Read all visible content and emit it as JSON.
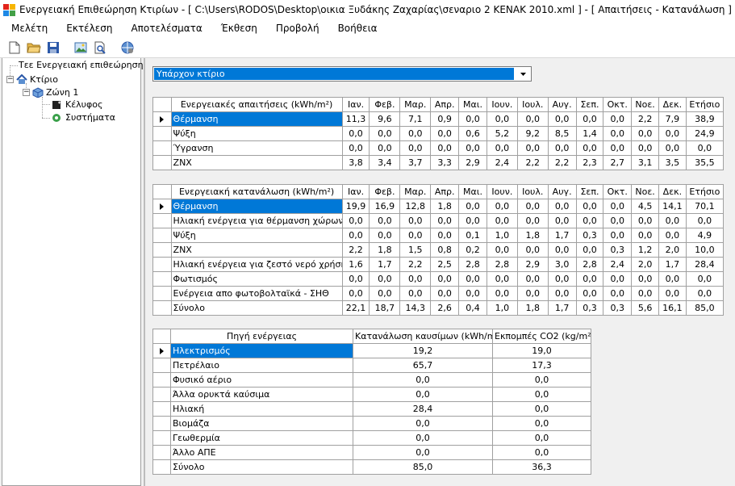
{
  "window": {
    "title": "Ενεργειακή Επιθεώρηση Κτιρίων - [ C:\\Users\\RODOS\\Desktop\\οικια Ξυδάκης Ζαχαρίας\\σεναριο 2 ΚΕΝΑΚ 2010.xml ] - [ Απαιτήσεις - Κατανάλωση ]"
  },
  "menu": [
    "Μελέτη",
    "Εκτέλεση",
    "Αποτελέσματα",
    "Έκθεση",
    "Προβολή",
    "Βοήθεια"
  ],
  "tree": {
    "root": "Τεε Ενεργειακή επιθεώρηση",
    "building": "Κτίριο",
    "zone": "Ζώνη 1",
    "shell": "Κέλυφος",
    "systems": "Συστήματα"
  },
  "combo": {
    "value": "Υπάρχον κτίριο"
  },
  "months": [
    "Ιαν.",
    "Φεβ.",
    "Μαρ.",
    "Απρ.",
    "Μαι.",
    "Ιουν.",
    "Ιουλ.",
    "Αυγ.",
    "Σεπ.",
    "Οκτ.",
    "Νοε.",
    "Δεκ.",
    "Ετήσιο"
  ],
  "demand": {
    "header": "Ενεργειακές απαιτήσεις (kWh/m²)",
    "rows": [
      {
        "label": "Θέρμανση",
        "values": [
          "11,3",
          "9,6",
          "7,1",
          "0,9",
          "0,0",
          "0,0",
          "0,0",
          "0,0",
          "0,0",
          "0,0",
          "2,2",
          "7,9",
          "38,9"
        ]
      },
      {
        "label": "Ψύξη",
        "values": [
          "0,0",
          "0,0",
          "0,0",
          "0,0",
          "0,6",
          "5,2",
          "9,2",
          "8,5",
          "1,4",
          "0,0",
          "0,0",
          "0,0",
          "24,9"
        ]
      },
      {
        "label": "Ύγρανση",
        "values": [
          "0,0",
          "0,0",
          "0,0",
          "0,0",
          "0,0",
          "0,0",
          "0,0",
          "0,0",
          "0,0",
          "0,0",
          "0,0",
          "0,0",
          "0,0"
        ]
      },
      {
        "label": "ZNX",
        "values": [
          "3,8",
          "3,4",
          "3,7",
          "3,3",
          "2,9",
          "2,4",
          "2,2",
          "2,2",
          "2,3",
          "2,7",
          "3,1",
          "3,5",
          "35,5"
        ]
      }
    ]
  },
  "consumption": {
    "header": "Ενεργειακή κατανάλωση (kWh/m²)",
    "rows": [
      {
        "label": "Θέρμανση",
        "values": [
          "19,9",
          "16,9",
          "12,8",
          "1,8",
          "0,0",
          "0,0",
          "0,0",
          "0,0",
          "0,0",
          "0,0",
          "4,5",
          "14,1",
          "70,1"
        ]
      },
      {
        "label": "Ηλιακή ενέργεια για θέρμανση χώρων",
        "values": [
          "0,0",
          "0,0",
          "0,0",
          "0,0",
          "0,0",
          "0,0",
          "0,0",
          "0,0",
          "0,0",
          "0,0",
          "0,0",
          "0,0",
          "0,0"
        ]
      },
      {
        "label": "Ψύξη",
        "values": [
          "0,0",
          "0,0",
          "0,0",
          "0,0",
          "0,1",
          "1,0",
          "1,8",
          "1,7",
          "0,3",
          "0,0",
          "0,0",
          "0,0",
          "4,9"
        ]
      },
      {
        "label": "ZNX",
        "values": [
          "2,2",
          "1,8",
          "1,5",
          "0,8",
          "0,2",
          "0,0",
          "0,0",
          "0,0",
          "0,0",
          "0,3",
          "1,2",
          "2,0",
          "10,0"
        ]
      },
      {
        "label": "Ηλιακή ενέργεια για ζεστό νερό χρήσης",
        "values": [
          "1,6",
          "1,7",
          "2,2",
          "2,5",
          "2,8",
          "2,8",
          "2,9",
          "3,0",
          "2,8",
          "2,4",
          "2,0",
          "1,7",
          "28,4"
        ]
      },
      {
        "label": "Φωτισμός",
        "values": [
          "0,0",
          "0,0",
          "0,0",
          "0,0",
          "0,0",
          "0,0",
          "0,0",
          "0,0",
          "0,0",
          "0,0",
          "0,0",
          "0,0",
          "0,0"
        ]
      },
      {
        "label": "Ενέργεια απο φωτοβολταϊκά - ΣΗΘ",
        "values": [
          "0,0",
          "0,0",
          "0,0",
          "0,0",
          "0,0",
          "0,0",
          "0,0",
          "0,0",
          "0,0",
          "0,0",
          "0,0",
          "0,0",
          "0,0"
        ]
      },
      {
        "label": "Σύνολο",
        "values": [
          "22,1",
          "18,7",
          "14,3",
          "2,6",
          "0,4",
          "1,0",
          "1,8",
          "1,7",
          "0,3",
          "0,3",
          "5,6",
          "16,1",
          "85,0"
        ]
      }
    ]
  },
  "sources": {
    "headers": [
      "Πηγή ενέργειας",
      "Κατανάλωση καυσίμων (kWh/m²)",
      "Εκπομπές CO2 (kg/m²)"
    ],
    "rows": [
      {
        "label": "Ηλεκτρισμός",
        "fuel": "19,2",
        "co2": "19,0"
      },
      {
        "label": "Πετρέλαιο",
        "fuel": "65,7",
        "co2": "17,3"
      },
      {
        "label": "Φυσικό αέριο",
        "fuel": "0,0",
        "co2": "0,0"
      },
      {
        "label": "Άλλα ορυκτά καύσιμα",
        "fuel": "0,0",
        "co2": "0,0"
      },
      {
        "label": "Ηλιακή",
        "fuel": "28,4",
        "co2": "0,0"
      },
      {
        "label": "Βιομάζα",
        "fuel": "0,0",
        "co2": "0,0"
      },
      {
        "label": "Γεωθερμία",
        "fuel": "0,0",
        "co2": "0,0"
      },
      {
        "label": "Άλλο ΑΠΕ",
        "fuel": "0,0",
        "co2": "0,0"
      },
      {
        "label": "Σύνολο",
        "fuel": "85,0",
        "co2": "36,3"
      }
    ]
  }
}
